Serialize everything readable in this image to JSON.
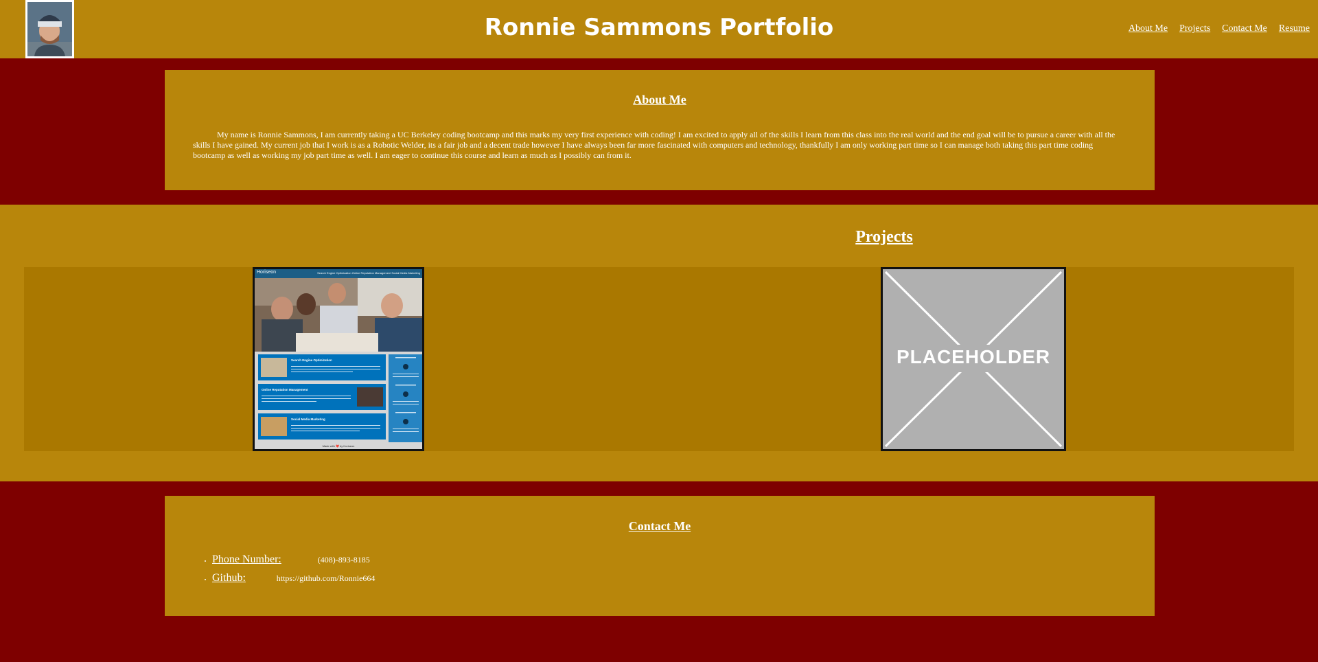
{
  "header": {
    "title": "Ronnie Sammons Portfolio",
    "nav": [
      "About Me",
      "Projects",
      "Contact Me",
      "Resume"
    ]
  },
  "about": {
    "heading": "About Me",
    "text": "My name is Ronnie Sammons, I am currently taking a UC Berkeley coding bootcamp and this marks my very first experience with coding! I am excited to apply all of the skills I learn from this class into the real world and the end goal will be to pursue a career with all the skills I have gained. My current job that I work is as a Robotic Welder, its a fair job and a decent trade however I have always been far more fascinated with computers and technology, thankfully I am only working part time so I can manage both taking this part time coding bootcamp as well as working my job part time as well. I am eager to continue this course and learn as much as I possibly can from it."
  },
  "projects": {
    "heading": "Projects",
    "cards": [
      {
        "name": "horiseon",
        "logo": "Horiseon",
        "nav_text": "Search Engine Optimization   Online Reputation Management   Social Media Marketing",
        "sections": [
          "Search Engine Optimization",
          "Online Reputation Management",
          "Social Media Marketing"
        ],
        "footer": "Made with ❤️ by Horiseon"
      },
      {
        "name": "placeholder",
        "label": "PLACEHOLDER"
      }
    ]
  },
  "contact": {
    "heading": "Contact Me",
    "phone_label": "Phone Number:",
    "phone_value": "(408)-893-8185",
    "github_label": "Github:",
    "github_value": "https://github.com/Ronnie664"
  },
  "colors": {
    "background": "#7e0000",
    "section": "#b8860b",
    "projects_strip": "#aa7800",
    "text": "#ffffff"
  }
}
